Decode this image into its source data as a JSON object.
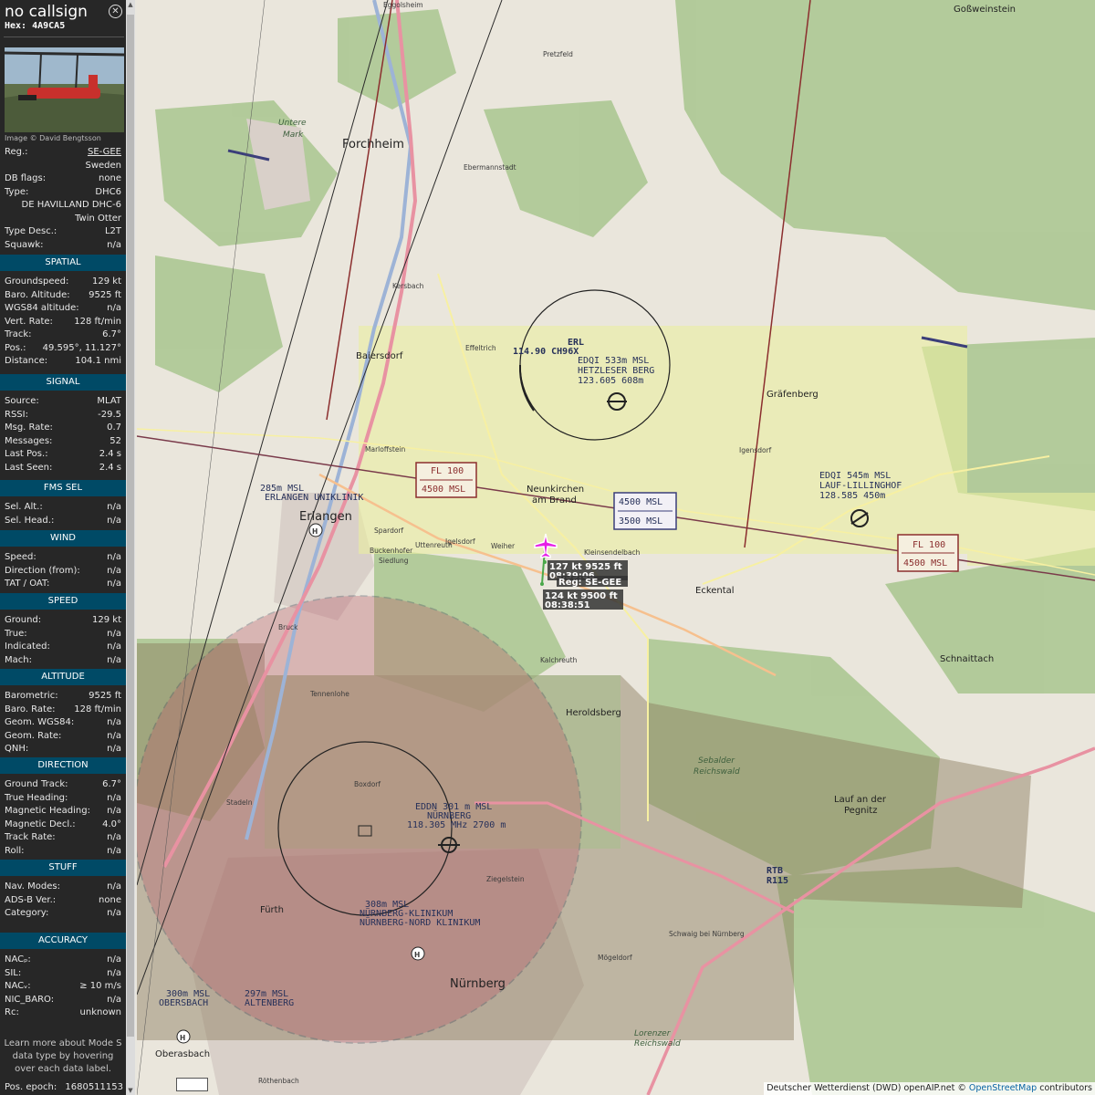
{
  "header": {
    "callsign": "no callsign",
    "hex": "Hex: 4A9CA5",
    "close_icon": "close-circle-icon"
  },
  "photo": {
    "credit": "Image © David Bengtsson"
  },
  "info": [
    {
      "k": "Reg.:",
      "v": "SE-GEE"
    },
    {
      "k": "",
      "v": "Sweden"
    },
    {
      "k": "DB flags:",
      "v": "none"
    },
    {
      "k": "Type:",
      "v": "DHC6"
    },
    {
      "k": "",
      "v": "DE HAVILLAND DHC-6"
    },
    {
      "k": "",
      "v": "Twin Otter"
    },
    {
      "k": "Type Desc.:",
      "v": "L2T"
    },
    {
      "k": "Squawk:",
      "v": "n/a"
    }
  ],
  "sections": [
    {
      "title": "SPATIAL",
      "rows": [
        {
          "k": "Groundspeed:",
          "v": "129 kt"
        },
        {
          "k": "Baro. Altitude:",
          "v": "9525 ft"
        },
        {
          "k": "WGS84 altitude:",
          "v": "n/a"
        },
        {
          "k": "Vert. Rate:",
          "v": "128 ft/min"
        },
        {
          "k": "Track:",
          "v": "6.7°"
        },
        {
          "k": "Pos.:",
          "v": "49.595°, 11.127°"
        },
        {
          "k": "Distance:",
          "v": "104.1 nmi"
        }
      ]
    },
    {
      "title": "SIGNAL",
      "rows": [
        {
          "k": "Source:",
          "v": "MLAT"
        },
        {
          "k": "RSSI:",
          "v": "-29.5"
        },
        {
          "k": "Msg. Rate:",
          "v": "0.7"
        },
        {
          "k": "Messages:",
          "v": "52"
        },
        {
          "k": "Last Pos.:",
          "v": "2.4 s"
        },
        {
          "k": "Last Seen:",
          "v": "2.4 s"
        }
      ]
    },
    {
      "title": "FMS SEL",
      "rows": [
        {
          "k": "Sel. Alt.:",
          "v": "n/a"
        },
        {
          "k": "Sel. Head.:",
          "v": "n/a"
        }
      ]
    },
    {
      "title": "WIND",
      "rows": [
        {
          "k": "Speed:",
          "v": "n/a"
        },
        {
          "k": "Direction (from):",
          "v": "n/a"
        },
        {
          "k": "TAT / OAT:",
          "v": "n/a"
        }
      ]
    },
    {
      "title": "SPEED",
      "rows": [
        {
          "k": "Ground:",
          "v": "129 kt"
        },
        {
          "k": "True:",
          "v": "n/a"
        },
        {
          "k": "Indicated:",
          "v": "n/a"
        },
        {
          "k": "Mach:",
          "v": "n/a"
        }
      ]
    },
    {
      "title": "ALTITUDE",
      "rows": [
        {
          "k": "Barometric:",
          "v": "9525 ft"
        },
        {
          "k": "Baro. Rate:",
          "v": "128 ft/min"
        },
        {
          "k": "Geom. WGS84:",
          "v": "n/a"
        },
        {
          "k": "Geom. Rate:",
          "v": "n/a"
        },
        {
          "k": "QNH:",
          "v": "n/a"
        }
      ]
    },
    {
      "title": "DIRECTION",
      "rows": [
        {
          "k": "Ground Track:",
          "v": "6.7°"
        },
        {
          "k": "True Heading:",
          "v": "n/a"
        },
        {
          "k": "Magnetic Heading:",
          "v": "n/a"
        },
        {
          "k": "Magnetic Decl.:",
          "v": "4.0°"
        },
        {
          "k": "Track Rate:",
          "v": "n/a"
        },
        {
          "k": "Roll:",
          "v": "n/a"
        }
      ]
    },
    {
      "title": "STUFF",
      "rows": [
        {
          "k": "Nav. Modes:",
          "v": "n/a"
        },
        {
          "k": "ADS-B Ver.:",
          "v": "none"
        },
        {
          "k": "Category:",
          "v": "n/a"
        }
      ]
    },
    {
      "title": "ACCURACY",
      "rows": [
        {
          "k": "NACₚ:",
          "v": "n/a"
        },
        {
          "k": "SIL:",
          "v": "n/a"
        },
        {
          "k": "NACᵥ:",
          "v": "≥ 10 m/s"
        },
        {
          "k": "NIC_BARO:",
          "v": "n/a"
        },
        {
          "k": "Rc:",
          "v": "unknown"
        }
      ]
    }
  ],
  "footer": {
    "text": "Learn more about Mode S data type by hovering over each data label.",
    "epoch_k": "Pos. epoch:",
    "epoch_v": "1680511153"
  },
  "map": {
    "attribution_prefix": "Deutscher Wetterdienst (DWD) openAIP.net © ",
    "attribution_link": "OpenStreetMap",
    "attribution_suffix": " contributors",
    "airspace": {
      "fl100_a": "FL 100",
      "msl4500_a": "4500 MSL",
      "fl100_b": "FL 100",
      "msl4500_b": "4500 MSL",
      "box_upper": "4500 MSL",
      "box_lower": "3500 MSL"
    },
    "navaids": {
      "erl_name": "ERL",
      "erl_freq": "114.90  CH96X",
      "rtb_name": "RTB",
      "rtb_freq": "R115",
      "eddq_a": "EDQI 533m MSL",
      "eddq_b": "HETZLESER BERG",
      "eddq_c": "123.605 608m",
      "eddi_a": "EDQI 545m MSL",
      "eddi_b": "LAUF-LILLINGHOF",
      "eddi_c": "128.585 450m",
      "erl_klin_a": "285m MSL",
      "erl_klin_b": "ERLANGEN UNIKLINIK",
      "eddn_a": "EDDN 301 m MSL",
      "eddn_b": "NÜRNBERG",
      "eddn_c": "118.305 MHz 2700 m",
      "nk_a": "308m MSL",
      "nk_b": "NÜRNBERG-KLINIKUM",
      "nk_c": "NÜRNBERG-NORD KLINIKUM",
      "alt_a": "297m MSL",
      "alt_b": "ALTENBERG",
      "ober_a": "300m MSL",
      "ober_b": "OBERSBACH"
    },
    "aircraft": {
      "label1_a": "127 kt  9525 ft",
      "label1_b": "08:39:06",
      "label2": "Reg: SE-GEE",
      "label3_a": "124 kt  9500 ft",
      "label3_b": "08:38:51"
    },
    "places": {
      "forchheim": "Forchheim",
      "erlangen": "Erlangen",
      "nurnberg": "Nürnberg",
      "furth": "Fürth",
      "baiersdorf": "Baiersdorf",
      "grafenberg": "Gräfenberg",
      "eckental": "Eckental",
      "heroldsberg": "Heroldsberg",
      "neunkirchen": "Neunkirchen",
      "am_brand": "am Brand",
      "lauf": "Lauf an der",
      "pegnitz": "Pegnitz",
      "schnaittach": "Schnaittach",
      "gossweinstein": "Goßweinstein",
      "untere_mark": "Untere",
      "mark": "Mark",
      "sebalder": "Sebalder",
      "reichswald": "Reichswald",
      "lorenzer": "Lorenzer",
      "reichswald2": "Reichswald",
      "ebermannstadt": "Ebermannstadt",
      "eggolsheim": "Eggolsheim",
      "kersbach": "Kersbach",
      "weiher": "Weiher",
      "pretzfeld": "Pretzfeld",
      "igensdorf": "Igensdorf",
      "kalchreuth": "Kalchreuth",
      "buckenhof": "Buckenhofer",
      "siedlung": "Siedlung",
      "tennenlohe": "Tennenlohe",
      "boxdorf": "Boxdorf",
      "ziegelstein": "Ziegelstein",
      "mogeldorf": "Mögeldorf",
      "schwaig": "Schwaig bei Nürnberg",
      "oberasbach": "Oberasbach",
      "stadeln": "Stadeln",
      "rohrbach": "Röthenbach",
      "bruck": "Bruck",
      "effeltrich": "Effeltrich",
      "uttenreuth": "Uttenreuth",
      "kleinsendelbach": "Kleinsendelbach",
      "igelsdorf": "Igelsdorf",
      "spardorf": "Spardorf",
      "marloffstein": "Marloffstein"
    }
  }
}
